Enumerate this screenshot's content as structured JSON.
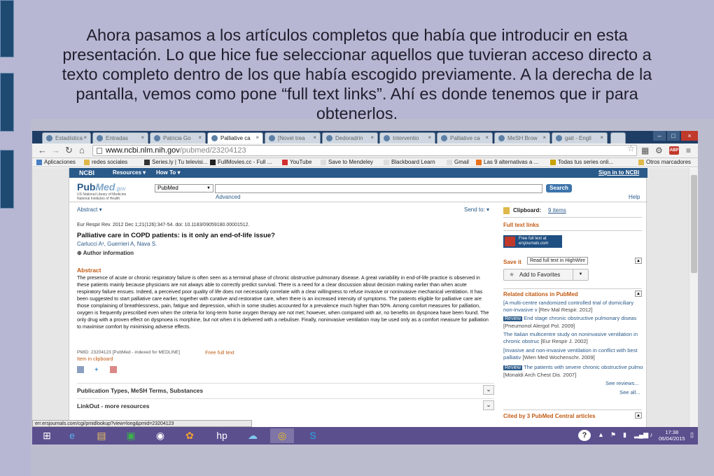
{
  "slide": {
    "caption": "Ahora pasamos a los artículos completos que había que introducir en esta presentación. Lo que hice fue seleccionar aquellos que tuvieran acceso directo a texto completo dentro de los que había escogido previamente. A la derecha de la pantalla, vemos como pone “full text links”. Ahí es donde tenemos que ir para obtenerlos."
  },
  "browser": {
    "tabs": [
      {
        "label": "Estadística"
      },
      {
        "label": "Entradas"
      },
      {
        "label": "Patricia Go"
      },
      {
        "label": "Palliative ca",
        "active": true
      },
      {
        "label": "[Novel trea"
      },
      {
        "label": "Dedoradrin"
      },
      {
        "label": "Interventio"
      },
      {
        "label": "Palliative ca"
      },
      {
        "label": "MeSH Brow"
      },
      {
        "label": "gait - Engli"
      }
    ],
    "url_host": "www.ncbi.nlm.nih.gov",
    "url_path": "/pubmed/23204123",
    "bookmarks": [
      "Aplicaciones",
      "redes sociales",
      "Series.ly | Tu televisi...",
      "FullMovies.cc - Full ...",
      "YouTube",
      "Save to Mendeley",
      "Blackboard Learn",
      "Gmail",
      "Las 9 alternativas a ...",
      "Todas tus series onli...",
      "Otros marcadores"
    ],
    "status_url": "err.ersjournals.com/cgi/pmidlookup?view=long&pmid=23204123"
  },
  "ncbi": {
    "logo": "NCBI",
    "resources": "Resources ▾",
    "howto": "How To ▾",
    "signin": "Sign in to NCBI"
  },
  "pubmed": {
    "logo_main": "Pub",
    "logo_med": "Med",
    "logo_gov": ".gov",
    "logo_sub1": "US National Library of Medicine",
    "logo_sub2": "National Institutes of Health",
    "db": "PubMed",
    "search_btn": "Search",
    "advanced": "Advanced",
    "help": "Help"
  },
  "article": {
    "format": "Abstract ▾",
    "send_to": "Send to: ▾",
    "citation": "Eur Respir Rev. 2012 Dec 1;21(126):347-54. doi: 10.1183/09059180.00001512.",
    "title": "Palliative care in COPD patients: is it only an end-of-life issue?",
    "authors": "Carlucci A¹, Guerrieri A, Nava S.",
    "author_info": "⊕ Author information",
    "abstract_head": "Abstract",
    "abstract": "The presence of acute or chronic respiratory failure is often seen as a terminal phase of chronic obstructive pulmonary disease. A great variability in end-of-life practice is observed in these patients mainly because physicians are not always able to correctly predict survival. There is a need for a clear discussion about decision making earlier than when acute respiratory failure ensues. Indeed, a perceived poor quality of life does not necessarily correlate with a clear willingness to refuse invasive or noninvasive mechanical ventilation. It has been suggested to start palliative care earlier, together with curative and restorative care, when there is an increased intensity of symptoms. The patients eligible for palliative care are those complaining of breathlessness, pain, fatigue and depression, which in some studies accounted for a prevalence much higher than 50%. Among comfort measures for palliation, oxygen is frequently prescribed even when the criteria for long-term home oxygen therapy are not met; however, when compared with air, no benefits on dyspnoea have been found. The only drug with a proven effect on dyspnoea is morphine, but not when it is delivered with a nebuliser. Finally, noninvasive ventilation may be used only as a comfort measure for palliation to maximise comfort by minimising adverse effects.",
    "pmid": "PMID: 23204123 [PubMed - indexed for MEDLINE]",
    "free_full_text": "Free full text",
    "in_clipboard": "Item in clipboard",
    "pub_types": "Publication Types, MeSH Terms, Substances",
    "linkout": "LinkOut - more resources"
  },
  "sidebar": {
    "clipboard_label": "Clipboard:",
    "clipboard_items": "9 items",
    "full_text_head": "Full text links",
    "badge_line1": "Free full text at",
    "badge_line2": "ersjournals.com",
    "tooltip": "Read full text in HighWire",
    "save_items": "Save it",
    "add_fav": "Add to Favorites",
    "related_head": "Related citations in PubMed",
    "related": [
      {
        "title": "[A multi-centre randomized controlled trial of domiciliary non-invasive v",
        "src": "[Rev Mal Respir. 2012]"
      },
      {
        "review": "Review",
        "title": "End stage chronic obstructive pulmonary diseas",
        "src": "[Pneumonol Alergol Pol. 2009]"
      },
      {
        "title": "The Italian multicentre study on noninvasive ventilation in chronic obstruc",
        "src": "[Eur Respir J. 2002]"
      },
      {
        "title": "[Invasive and non-invasive ventilation in conflict with best palliativ",
        "src": "[Wien Med Wochenschr. 2009]"
      },
      {
        "review": "Review",
        "title": "The patients with severe chronic obstructive pulmo",
        "src": "[Monaldi Arch Chest Dis. 2007]"
      }
    ],
    "see_reviews": "See reviews...",
    "see_all": "See all...",
    "cited_head": "Cited by 3 PubMed Central articles"
  },
  "taskbar": {
    "time": "17:38",
    "date": "06/04/2015",
    "help": "?"
  }
}
